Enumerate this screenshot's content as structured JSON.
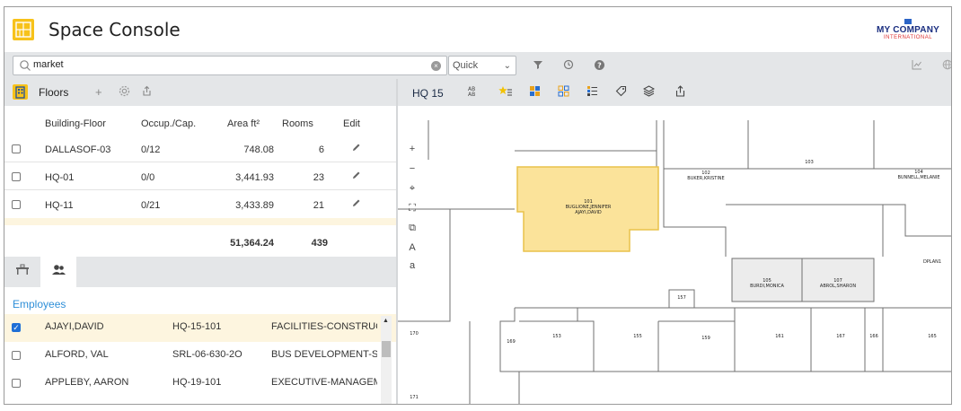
{
  "app": {
    "title": "Space Console"
  },
  "brand": {
    "name": "MY COMPANY",
    "tagline": "INTERNATIONAL"
  },
  "search": {
    "value": "market",
    "mode": "Quick"
  },
  "floors": {
    "title": "Floors",
    "columns": [
      "Building-Floor",
      "Occup./Cap.",
      "Area ft²",
      "Rooms",
      "Edit"
    ],
    "rows": [
      {
        "floor": "DALLASOF-03",
        "occ": "0/12",
        "area": "748.08",
        "rooms": "6"
      },
      {
        "floor": "HQ-01",
        "occ": "0/0",
        "area": "3,441.93",
        "rooms": "23"
      },
      {
        "floor": "HQ-11",
        "occ": "0/21",
        "area": "3,433.89",
        "rooms": "21"
      }
    ],
    "total_area": "51,364.24",
    "total_rooms": "439"
  },
  "employees": {
    "title": "Employees",
    "rows": [
      {
        "name": "AJAYI,DAVID",
        "room": "HQ-15-101",
        "dept": "FACILITIES-CONSTRUCTION",
        "checked": true
      },
      {
        "name": "ALFORD, VAL",
        "room": "SRL-06-630-2O",
        "dept": "BUS DEVELOPMENT-SALES",
        "checked": false
      },
      {
        "name": "APPLEBY, AARON",
        "room": "HQ-19-101",
        "dept": "EXECUTIVE-MANAGEMENT",
        "checked": false
      }
    ]
  },
  "map": {
    "title": "HQ 15",
    "rooms": {
      "r101": "101",
      "r101_line1": "BUGLIONE,JENNIFER",
      "r101_line2": "AJAYI,DAVID",
      "r102": "102",
      "r102_occ": "BUKER,KRISTINE",
      "r103": "103",
      "r104": "104",
      "r104_occ": "BUNNELL,MELANIE",
      "r105": "105",
      "r105_occ": "BURDI,MONICA",
      "r107": "107",
      "r107_occ": "ABROL,SHARON",
      "dplan": "DPLAN1",
      "r157": "157",
      "r153": "153",
      "r155": "155",
      "r159": "159",
      "r161": "161",
      "r167": "167",
      "r166": "166",
      "r165": "165",
      "r169": "169",
      "r170": "170",
      "r171": "171"
    },
    "highlight_color": "#fbe39a"
  }
}
